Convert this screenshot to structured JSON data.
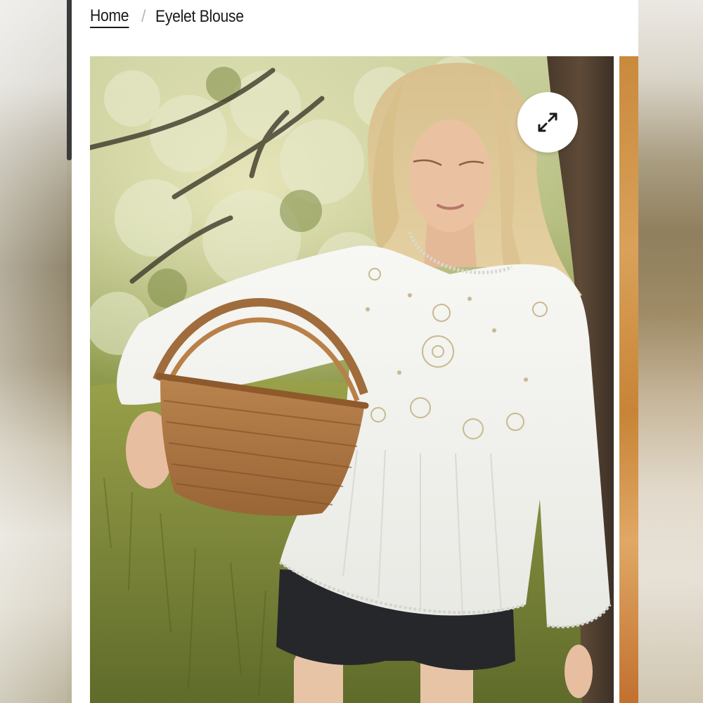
{
  "breadcrumb": {
    "home_label": "Home",
    "separator": "/",
    "current_label": "Eyelet Blouse"
  },
  "gallery": {
    "zoom_icon": "expand-arrows-icon"
  },
  "colors": {
    "text": "#1a1a1a",
    "separator": "#b9b9b9",
    "page_background": "#ffffff"
  }
}
